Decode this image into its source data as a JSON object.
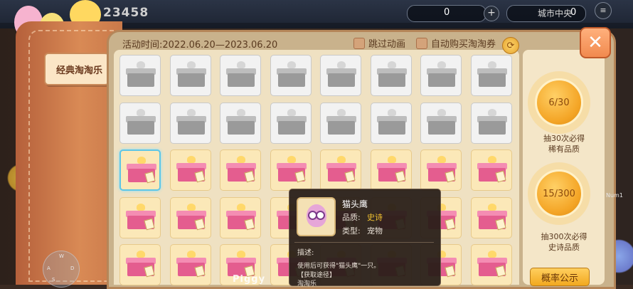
{
  "hud": {
    "coins": "23458",
    "resource_value": "0",
    "diamond_value": "0",
    "location": "城市中央"
  },
  "tab": {
    "label": "经典淘淘乐"
  },
  "header": {
    "activity_time": "活动时间:2022.06.20—2023.06.20",
    "skip_animation": "跳过动画",
    "auto_buy": "自动购买淘淘券"
  },
  "grid": {
    "rows": [
      [
        "grey",
        "grey",
        "grey",
        "grey",
        "grey",
        "grey",
        "grey",
        "grey"
      ],
      [
        "grey",
        "grey",
        "grey",
        "grey",
        "grey",
        "grey",
        "grey",
        "grey"
      ],
      [
        "pink-selected",
        "pink",
        "pink",
        "pink",
        "pink",
        "pink",
        "pink",
        "pink"
      ],
      [
        "pink",
        "pink",
        "pink",
        "pink",
        "pink",
        "pink",
        "pink",
        "pink"
      ],
      [
        "pink",
        "pink",
        "pink",
        "pink",
        "pink",
        "pink",
        "pink",
        "pink"
      ]
    ]
  },
  "tooltip": {
    "name": "猫头鹰",
    "quality_label": "品质:",
    "quality_value": "史诗",
    "type_label": "类型:",
    "type_value": "宠物",
    "desc_title": "描述:",
    "desc_line1": "使用后可获得\"猫头鹰\"一只。",
    "desc_line2": "【获取途径】",
    "desc_line3": "淘淘乐",
    "quality_color": "#f2c230"
  },
  "rewards": [
    {
      "progress": "6/30",
      "line1": "抽30次必得",
      "line2": "稀有品质"
    },
    {
      "progress": "15/300",
      "line1": "抽300次必得",
      "line2": "史诗品质"
    }
  ],
  "probability_button": "概率公示",
  "joystick": {
    "w": "W",
    "a": "A",
    "s": "S",
    "d": "D"
  },
  "side_label": "Num1",
  "watermark": "Piggy"
}
